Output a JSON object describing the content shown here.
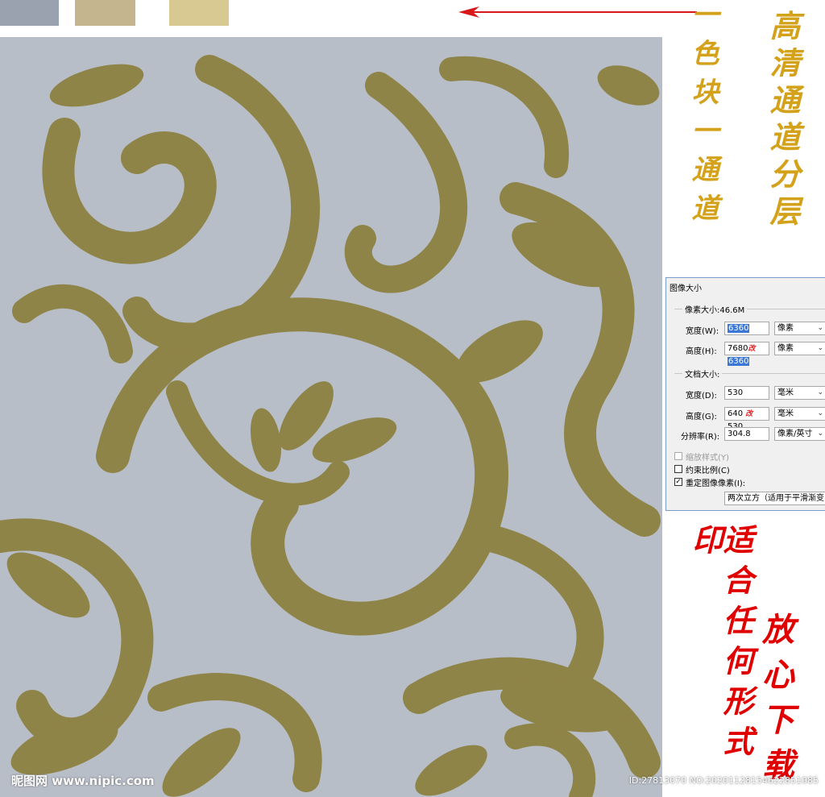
{
  "swatches": [
    {
      "name": "gray-blue",
      "color": "#9aa2b0"
    },
    {
      "name": "taupe",
      "color": "#c4b58e"
    },
    {
      "name": "khaki",
      "color": "#d8c892"
    }
  ],
  "pattern": {
    "background": "#b8bec8",
    "ornament": "#8f8447",
    "highlight": "#d9dde4"
  },
  "captions": {
    "hd_layers": "高清通道分层",
    "color_block": "一色块一通道",
    "print": "适合任何形式印",
    "download": "放心下载"
  },
  "caption_colors": {
    "gold": "#d4a21a",
    "red": "#e00000",
    "arrow": "#d81818"
  },
  "dialog": {
    "title": "图像大小",
    "pixel_group": "像素大小:46.6M",
    "width_label": "宽度(W):",
    "width_value": "6360",
    "width_unit": "像素",
    "height_label": "高度(H):",
    "height_value_old": "7680",
    "height_mark": "改",
    "height_value": "6360",
    "height_unit": "像素",
    "doc_group": "文档大小:",
    "doc_width_label": "宽度(D):",
    "doc_width_value": "530",
    "doc_width_unit": "毫米",
    "doc_height_label": "高度(G):",
    "doc_height_old": "640",
    "doc_height_mark": "改",
    "doc_height_value": "530",
    "doc_height_unit": "毫米",
    "resolution_label": "分辨率(R):",
    "resolution_value": "304.8",
    "resolution_unit": "像素/英寸",
    "scale_styles": "缩放样式(Y)",
    "constrain": "约束比例(C)",
    "resample": "重定图像像素(I):",
    "resample_method": "两次立方（适用于平滑渐变"
  },
  "watermarks": {
    "left": "昵图网 www.nipic.com",
    "right": "ID:27813070 NO:20201128154622851085"
  }
}
